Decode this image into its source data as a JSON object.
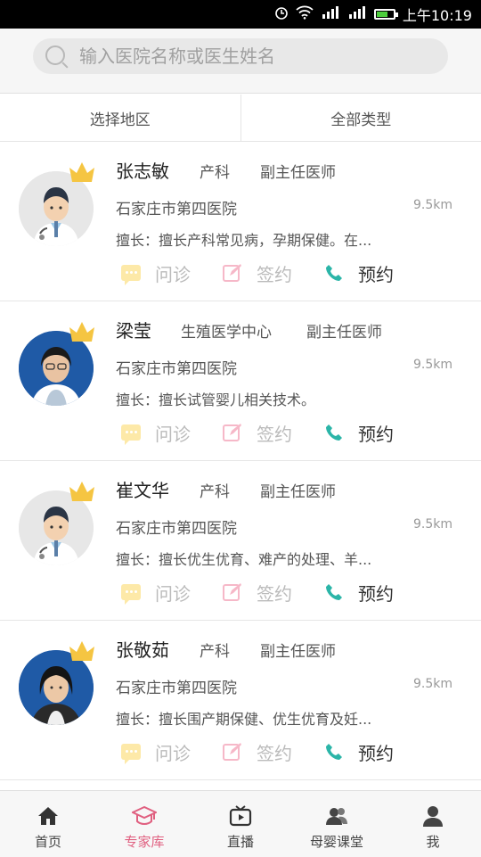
{
  "status_bar": {
    "time": "上午10:19"
  },
  "search": {
    "placeholder": "输入医院名称或医生姓名"
  },
  "filters": {
    "region": "选择地区",
    "type": "全部类型"
  },
  "doctors": [
    {
      "name": "张志敏",
      "dept": "产科",
      "title": "副主任医师",
      "hospital": "石家庄市第四医院",
      "distance": "9.5km",
      "specialty": "擅长：擅长产科常见病，孕期保健。在...",
      "avatar": "cartoon"
    },
    {
      "name": "梁莹",
      "dept": "生殖医学中心",
      "title": "副主任医师",
      "hospital": "石家庄市第四医院",
      "distance": "9.5km",
      "specialty": "擅长：擅长试管婴儿相关技术。",
      "avatar": "photo"
    },
    {
      "name": "崔文华",
      "dept": "产科",
      "title": "副主任医师",
      "hospital": "石家庄市第四医院",
      "distance": "9.5km",
      "specialty": "擅长：擅长优生优育、难产的处理、羊...",
      "avatar": "cartoon"
    },
    {
      "name": "张敬茹",
      "dept": "产科",
      "title": "副主任医师",
      "hospital": "石家庄市第四医院",
      "distance": "9.5km",
      "specialty": "擅长：擅长围产期保健、优生优育及妊...",
      "avatar": "photo"
    }
  ],
  "actions": {
    "consult": "问诊",
    "sign": "签约",
    "book": "预约"
  },
  "tabs": [
    {
      "label": "首页",
      "icon": "home-icon"
    },
    {
      "label": "专家库",
      "icon": "graduation-cap-icon"
    },
    {
      "label": "直播",
      "icon": "tv-icon"
    },
    {
      "label": "母婴课堂",
      "icon": "people-icon"
    },
    {
      "label": "我",
      "icon": "person-icon"
    }
  ],
  "colors": {
    "accent": "#e06080",
    "crown": "#f5c542",
    "phone": "#2bb5a8",
    "chat": "#fde9a8",
    "sign": "#f6b8c8"
  }
}
